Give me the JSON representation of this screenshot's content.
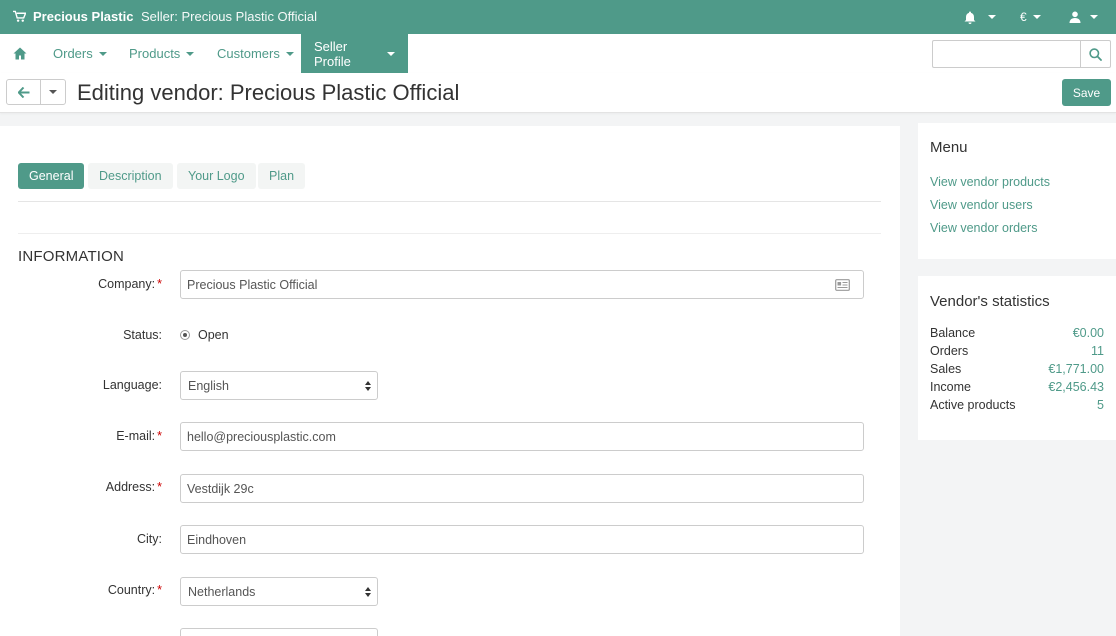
{
  "topbar": {
    "brand": "Precious Plastic",
    "seller": "Seller: Precious Plastic Official",
    "currency": "€",
    "icons": [
      "cart-icon",
      "bell-icon",
      "user-icon"
    ]
  },
  "nav": {
    "items": [
      {
        "label": "Orders"
      },
      {
        "label": "Products"
      },
      {
        "label": "Customers"
      },
      {
        "label": "Seller Profile"
      }
    ],
    "search": {
      "placeholder": "",
      "value": ""
    }
  },
  "title": {
    "text": "Editing vendor: Precious Plastic Official",
    "save_label": "Save"
  },
  "tabs": [
    {
      "label": "General"
    },
    {
      "label": "Description"
    },
    {
      "label": "Your Logo"
    },
    {
      "label": "Plan"
    }
  ],
  "form": {
    "section_title": "INFORMATION",
    "required_mark": "*",
    "company": {
      "label": "Company:",
      "value": "Precious Plastic Official"
    },
    "status": {
      "label": "Status:",
      "value": "Open"
    },
    "language": {
      "label": "Language:",
      "value": "English"
    },
    "email": {
      "label": "E-mail:",
      "value": "hello@preciousplastic.com"
    },
    "address": {
      "label": "Address:",
      "value": "Vestdijk 29c"
    },
    "city": {
      "label": "City:",
      "value": "Eindhoven"
    },
    "country": {
      "label": "Country:",
      "value": "Netherlands"
    }
  },
  "sidebar": {
    "menu": {
      "title": "Menu",
      "links": [
        "View vendor products",
        "View vendor users",
        "View vendor orders"
      ]
    },
    "stats": {
      "title": "Vendor's statistics",
      "rows": [
        {
          "label": "Balance",
          "value": "€0.00"
        },
        {
          "label": "Orders",
          "value": "11"
        },
        {
          "label": "Sales",
          "value": "€1,771.00"
        },
        {
          "label": "Income",
          "value": "€2,456.43"
        },
        {
          "label": "Active products",
          "value": "5"
        }
      ]
    }
  },
  "colors": {
    "accent": "#4f9a89",
    "background": "#f3f4f5"
  }
}
